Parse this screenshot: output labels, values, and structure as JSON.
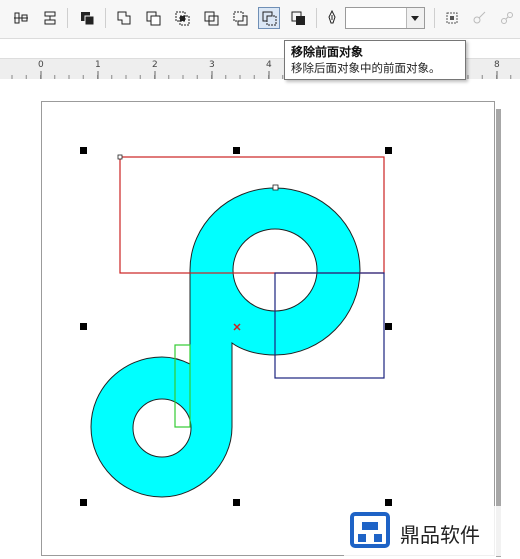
{
  "toolbar": {
    "tools": [
      {
        "icon": "align-distribute-icon"
      },
      {
        "icon": "text-options-icon"
      },
      {
        "icon": "combine-icon"
      },
      {
        "icon": "weld-icon"
      },
      {
        "icon": "trim-icon"
      },
      {
        "icon": "intersect-icon"
      },
      {
        "icon": "simplify-icon"
      },
      {
        "icon": "front-minus-back-icon"
      },
      {
        "icon": "back-minus-front-icon",
        "active": true
      },
      {
        "icon": "create-boundary-icon"
      },
      {
        "icon": "outline-pen-icon"
      }
    ],
    "outline_width": {
      "value": ""
    }
  },
  "tooltip": {
    "title": "移除前面对象",
    "description": "移除后面对象中的前面对象。"
  },
  "ruler": {
    "labels": [
      "0",
      "1",
      "2",
      "3",
      "4",
      "8"
    ]
  },
  "colors": {
    "shape_fill": "#00ffff",
    "rect_red": "#cc2222",
    "rect_blue": "#1a237e",
    "rect_green": "#33cc33",
    "active_button": "#dbe7f5"
  },
  "watermark": {
    "text": "鼎品软件"
  }
}
